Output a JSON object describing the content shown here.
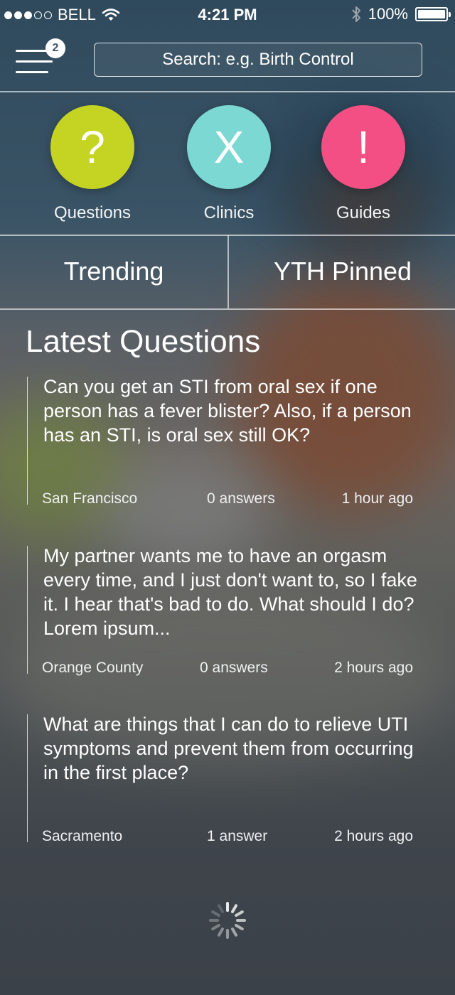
{
  "status_bar": {
    "signal_dots_filled": 3,
    "signal_dots_total": 5,
    "carrier": "BELL",
    "time": "4:21 PM",
    "battery": "100%",
    "icons": [
      "wifi-icon",
      "bluetooth-icon",
      "battery-icon"
    ]
  },
  "header": {
    "menu_badge": "2",
    "search_placeholder": "Search: e.g. Birth Control"
  },
  "nav": [
    {
      "label": "Questions",
      "symbol": "?",
      "color": "#c5d423"
    },
    {
      "label": "Clinics",
      "symbol": "X",
      "color": "#7cd8d2"
    },
    {
      "label": "Guides",
      "symbol": "!",
      "color": "#f44f84"
    }
  ],
  "tabs": {
    "trending": "Trending",
    "pinned": "YTH Pinned"
  },
  "latest": {
    "title": "Latest Questions",
    "items": [
      {
        "text": "Can you get an STI from oral sex if one person has a fever blister? Also, if a person has an STI, is oral sex still OK?",
        "location": "San Francisco",
        "answers": "0 answers",
        "time": "1 hour ago"
      },
      {
        "text": "My partner wants me to have an orgasm every time, and I just don't want to, so I fake it. I hear that's bad to do. What should I do? Lorem ipsum...",
        "location": "Orange County",
        "answers": "0 answers",
        "time": "2 hours ago"
      },
      {
        "text": "What are things that I can do to relieve UTI symptoms and prevent them from occurring in the first place?",
        "location": "Sacramento",
        "answers": "1 answer",
        "time": "2 hours ago"
      }
    ]
  },
  "loading": {
    "icon": "spinner-icon"
  }
}
